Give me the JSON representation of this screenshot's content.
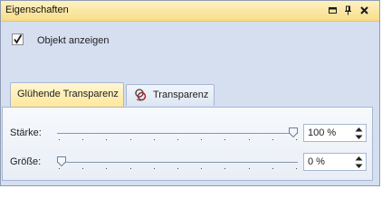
{
  "window": {
    "title": "Eigenschaften",
    "icons": [
      "maximize-icon",
      "pin-icon",
      "close-icon"
    ]
  },
  "show_object": {
    "label": "Objekt anzeigen",
    "checked": true
  },
  "tabs": [
    {
      "label": "Glühende Transparenz",
      "active": true
    },
    {
      "label": "Transparenz",
      "active": false,
      "icon": "transparency-icon"
    }
  ],
  "controls": [
    {
      "label": "Stärke:",
      "value": "100 %",
      "slider_fraction": 1.0
    },
    {
      "label": "Größe:",
      "value": "0 %",
      "slider_fraction": 0.0
    }
  ]
}
